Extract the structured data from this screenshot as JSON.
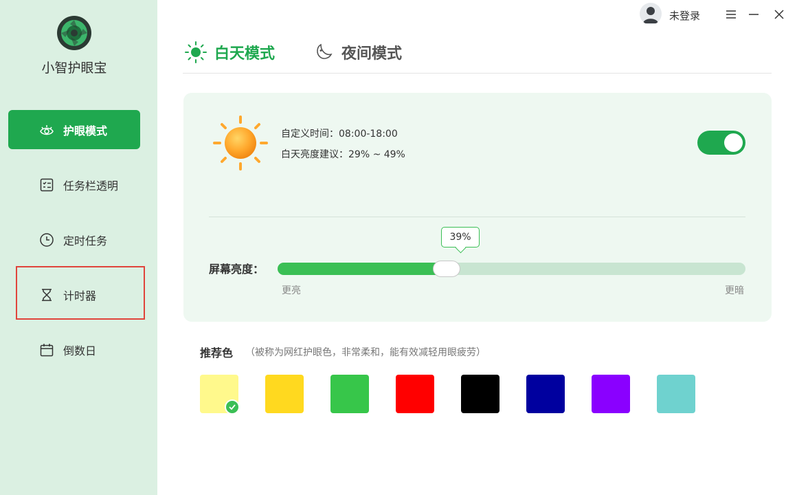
{
  "app": {
    "name": "小智护眼宝"
  },
  "sidebar": {
    "items": [
      {
        "label": "护眼模式",
        "icon": "eye-icon",
        "active": true
      },
      {
        "label": "任务栏透明",
        "icon": "taskbar-icon",
        "active": false
      },
      {
        "label": "定时任务",
        "icon": "clock-icon",
        "active": false
      },
      {
        "label": "计时器",
        "icon": "hourglass-icon",
        "active": false
      },
      {
        "label": "倒数日",
        "icon": "calendar-icon",
        "active": false
      }
    ]
  },
  "topbar": {
    "login_label": "未登录",
    "buttons": [
      "menu-icon",
      "minimize-icon",
      "close-icon"
    ]
  },
  "tabs": [
    {
      "label": "白天模式",
      "icon": "sun-icon",
      "active": true
    },
    {
      "label": "夜间模式",
      "icon": "moon-icon",
      "active": false
    }
  ],
  "day_card": {
    "custom_time": "自定义时间：08:00-18:00",
    "brightness_advice": "白天亮度建议：29% ~ 49%",
    "toggle_on": true
  },
  "brightness": {
    "label": "屏幕亮度：",
    "value_text": "39%",
    "value": 0.39,
    "min_label": "更亮",
    "max_label": "更暗"
  },
  "recommended": {
    "title": "推荐色",
    "note": "（被称为网红护眼色，非常柔和，能有效减轻用眼疲劳）",
    "colors": [
      "#fff98c",
      "#ffd91f",
      "#37c64a",
      "#ff0000",
      "#000000",
      "#00009f",
      "#8a00ff",
      "#6fd2cf"
    ],
    "selected_index": 0
  },
  "colors": {
    "accent": "#1fa84f",
    "sidebar_bg": "#dbf0e2",
    "card_bg": "#eef8f1",
    "highlight": "#e0443b"
  }
}
